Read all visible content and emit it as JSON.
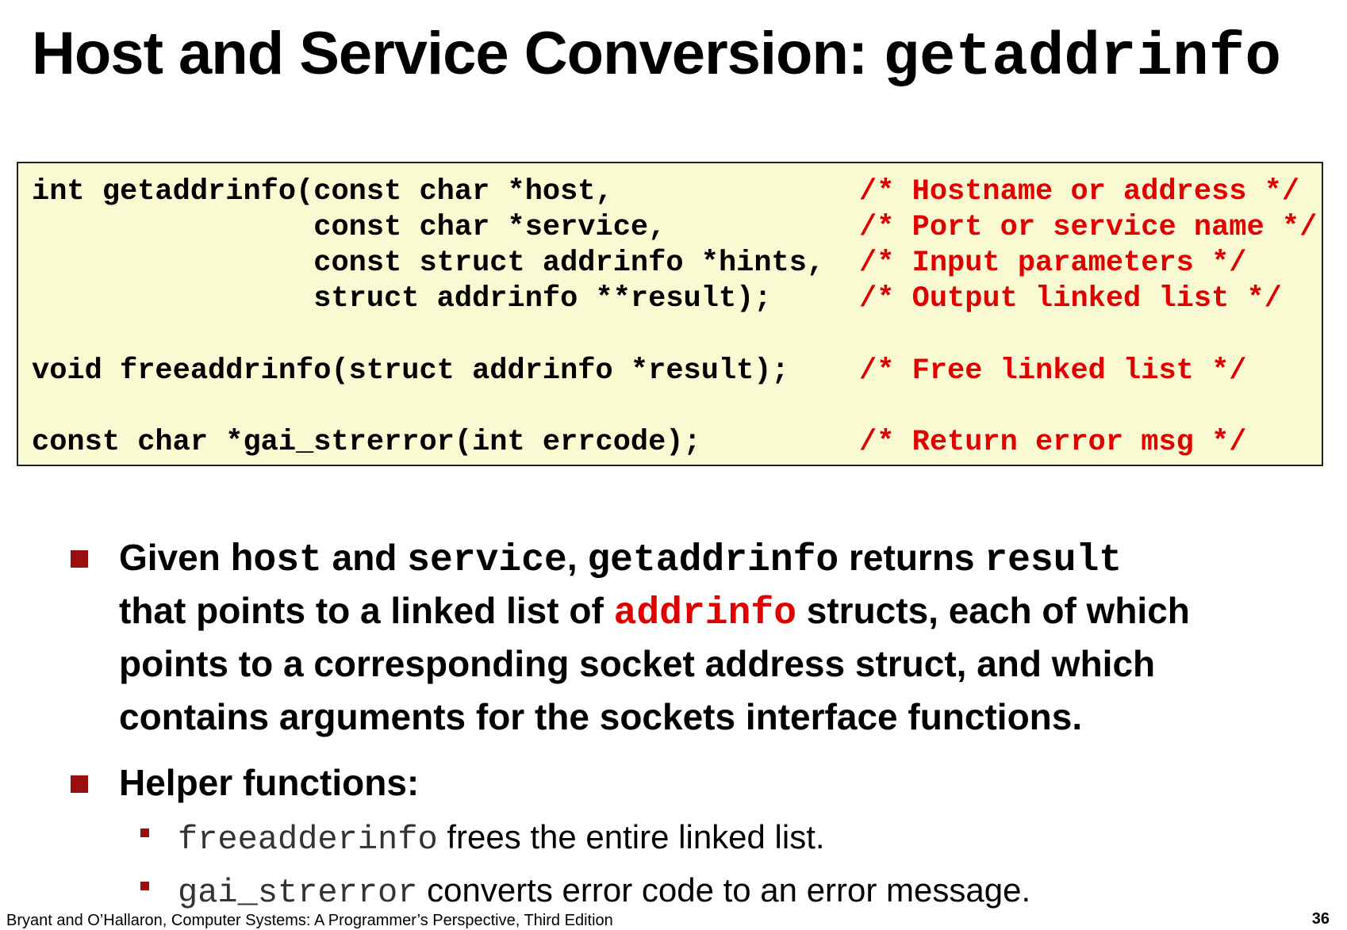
{
  "title": {
    "text": "Host and Service Conversion: ",
    "code": "getaddrinfo"
  },
  "code_block": {
    "lines": [
      {
        "code": "int getaddrinfo(const char *host,",
        "comment": "/* Hostname or address */"
      },
      {
        "code": "                const char *service,",
        "comment": "/* Port or service name */"
      },
      {
        "code": "                const struct addrinfo *hints,",
        "comment": "/* Input parameters */"
      },
      {
        "code": "                struct addrinfo **result);",
        "comment": "/* Output linked list */"
      },
      {
        "code": "void freeaddrinfo(struct addrinfo *result);",
        "comment": "/* Free linked list */"
      },
      {
        "code": "const char *gai_strerror(int errcode);",
        "comment": "/* Return error msg */"
      }
    ]
  },
  "bullet1": {
    "line1": {
      "t1": "Given ",
      "c1": "host",
      "t2": " and ",
      "c2": "service",
      "t3": ", ",
      "c3": "getaddrinfo",
      "t4": "  returns ",
      "c4": "result"
    },
    "line2": {
      "t1": "that points to a linked list of ",
      "c1": "addrinfo",
      "t2": " structs, each of which"
    },
    "line3": "points to a corresponding socket address struct, and which",
    "line4": "contains arguments for the sockets interface functions."
  },
  "bullet2": {
    "text": "Helper functions:",
    "items": [
      {
        "code": "freeadderinfo",
        "text": " frees the entire linked list."
      },
      {
        "code": "gai_strerror",
        "text": " converts error code to an error message."
      }
    ]
  },
  "footer": {
    "text": "Bryant and O’Hallaron, Computer Systems: A Programmer’s Perspective, Third Edition",
    "page": "36"
  },
  "colors": {
    "accent_red": "#e00000",
    "bullet": "#9a1010",
    "code_bg": "#fafad2"
  }
}
